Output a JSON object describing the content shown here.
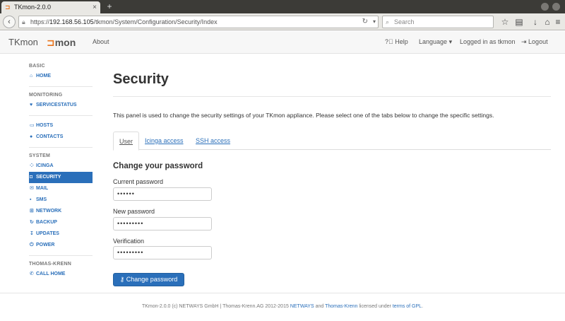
{
  "browser": {
    "tab_title": "TKmon-2.0.0",
    "tab_close": "×",
    "new_tab": "+",
    "url_prefix": "https://",
    "url_host": "192.168.56.105",
    "url_path": "/tkmon/System/Configuration/Security/Index",
    "search_placeholder": "Search",
    "icons": [
      "back-icon",
      "lock-icon",
      "reload-icon",
      "search-icon",
      "star-icon",
      "reader-icon",
      "download-icon",
      "home-icon",
      "menu-icon"
    ]
  },
  "header": {
    "brand": "TKmon",
    "logo_mark": "⊐",
    "logo_text": "mon",
    "about": "About",
    "help": "Help",
    "language": "Language",
    "logged_in": "Logged in as tkmon",
    "logout": "Logout"
  },
  "sidebar": {
    "basic": "BASIC",
    "home": "HOME",
    "monitoring": "MONITORING",
    "servicestatus": "SERVICESTATUS",
    "hosts": "HOSTS",
    "contacts": "CONTACTS",
    "system": "SYSTEM",
    "icinga": "ICINGA",
    "security": "SECURITY",
    "mail": "MAIL",
    "sms": "SMS",
    "network": "NETWORK",
    "backup": "BACKUP",
    "updates": "UPDATES",
    "power": "POWER",
    "thomas_krenn": "THOMAS-KRENN",
    "call_home": "CALL HOME"
  },
  "main": {
    "title": "Security",
    "intro": "This panel is used to change the security settings of your TKmon appliance. Please select one of the tabs below to change the specific settings.",
    "tabs": [
      "User",
      "Icinga access",
      "SSH access"
    ],
    "form_title": "Change your password",
    "current_label": "Current password",
    "current_value": "••••••",
    "new_label": "New password",
    "new_value": "•••••••••",
    "verify_label": "Verification",
    "verify_value": "•••••••••",
    "submit": "Change password"
  },
  "footer": {
    "text1": "TKmon-2.0.0 (c) NETWAYS GmbH | Thomas-Krenn.AG 2012-2015 ",
    "netways": "NETWAYS",
    "and": " and ",
    "thomas_krenn": "Thomas-Krenn",
    "licensed": " licensed under ",
    "gpl": "terms of GPL",
    "period": "."
  },
  "colors": {
    "accent": "#2a6fba",
    "brand_orange": "#e9731b"
  }
}
